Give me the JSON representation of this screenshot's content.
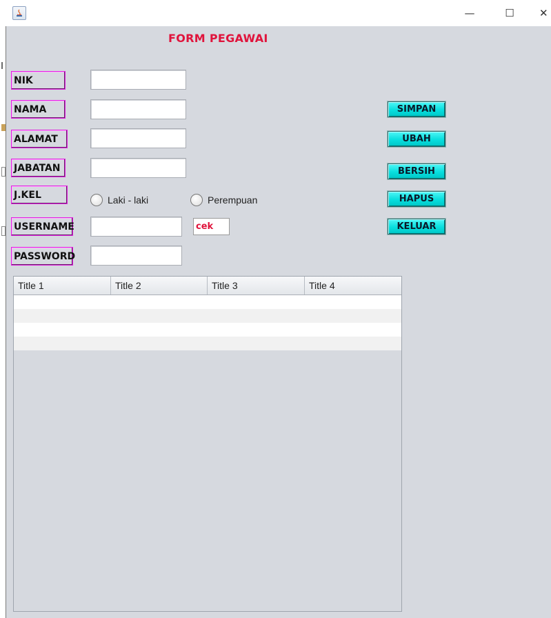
{
  "window": {
    "title": "",
    "controls": {
      "minimize": "—",
      "maximize": "☐",
      "close": "✕"
    }
  },
  "form": {
    "title": "FORM PEGAWAI",
    "labels": {
      "nik": "NIK",
      "nama": "NAMA",
      "alamat": "ALAMAT",
      "jabatan": "JABATAN",
      "jkel": "J.KEL",
      "username": "USERNAME",
      "password": "PASSWORD"
    },
    "fields": {
      "nik": "",
      "nama": "",
      "alamat": "",
      "jabatan": "",
      "username": "",
      "password": ""
    },
    "gender": {
      "option1": "Laki - laki",
      "option2": "Perempuan",
      "selected": ""
    },
    "cek_label": "cek"
  },
  "buttons": {
    "simpan": "SIMPAN",
    "ubah": "UBAH",
    "bersih": "BERSIH",
    "hapus": "HAPUS",
    "keluar": "KELUAR"
  },
  "colors": {
    "accent_red": "#e0143c",
    "label_border": "#e020e0",
    "button_cyan": "#08dede",
    "panel_bg": "#d6d9df"
  },
  "table": {
    "columns": [
      "Title 1",
      "Title 2",
      "Title 3",
      "Title 4"
    ],
    "rows": [
      [
        "",
        "",
        "",
        ""
      ],
      [
        "",
        "",
        "",
        ""
      ],
      [
        "",
        "",
        "",
        ""
      ],
      [
        "",
        "",
        "",
        ""
      ]
    ]
  }
}
